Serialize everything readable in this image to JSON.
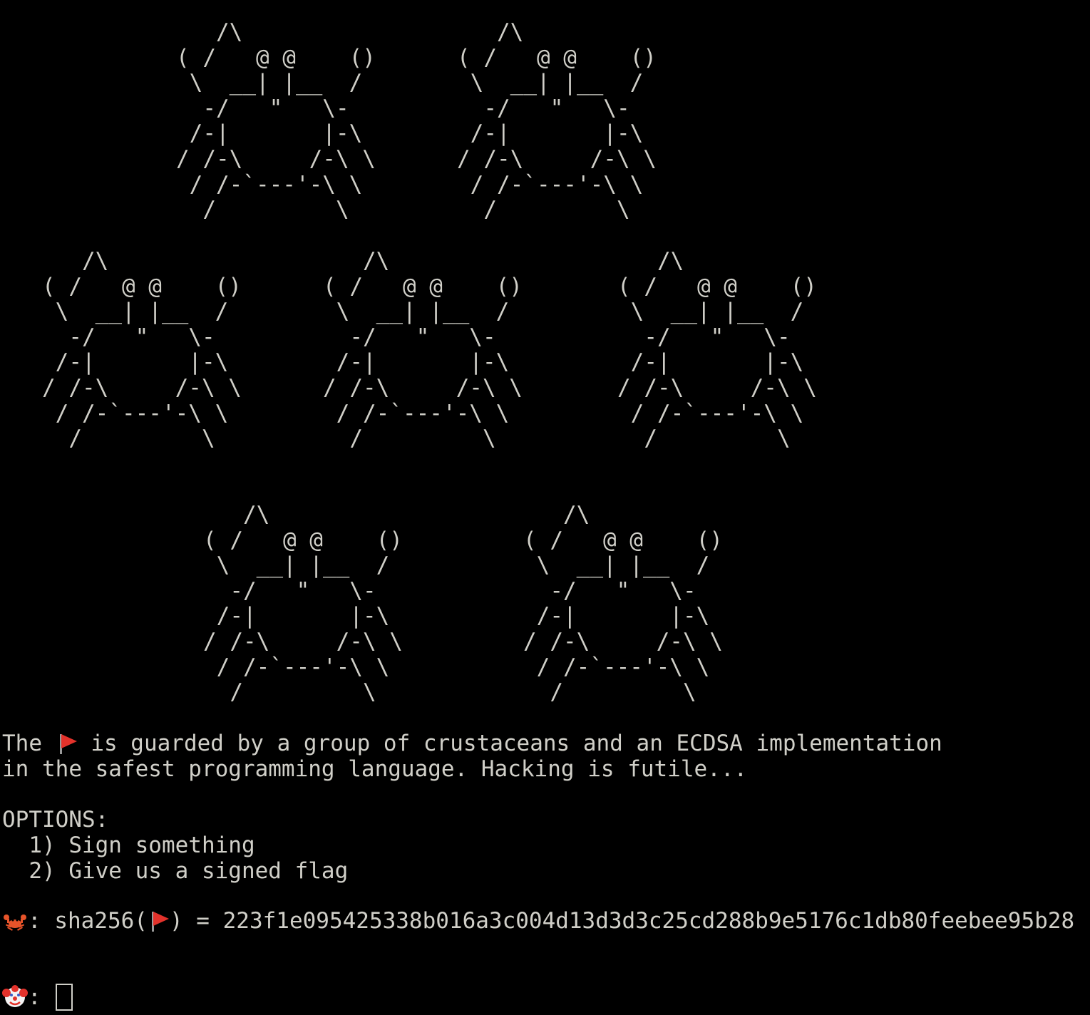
{
  "crab_art": "   /\\\n( /   @ @    ()\n \\  __| |__  /\n  -/   \"   \\-\n /-|       |-\\\n/ /-\\     /-\\ \\\n / /-`---'-\\ \\\n  /         \\",
  "intro": {
    "line1_before": "The ",
    "line1_after": " is guarded by a group of crustaceans and an ECDSA implementation",
    "line2": "in the safest programming language. Hacking is futile..."
  },
  "options": {
    "header": "OPTIONS:",
    "items": [
      "  1) Sign something",
      "  2) Give us a signed flag"
    ]
  },
  "hash_line": {
    "before": ": sha256(",
    "after": ") = 223f1e095425338b016a3c004d13d3d3c25cd288b9e5176c1db80feebee95b28"
  },
  "prompt": {
    "separator": ": "
  },
  "icons": {
    "flag": "triangular-flag-icon",
    "crab": "crab-icon",
    "clown": "clown-face-icon"
  },
  "colors": {
    "background": "#000000",
    "text": "#d0cfc8",
    "flag_red": "#e3322b",
    "crab_orange": "#e8542a"
  }
}
